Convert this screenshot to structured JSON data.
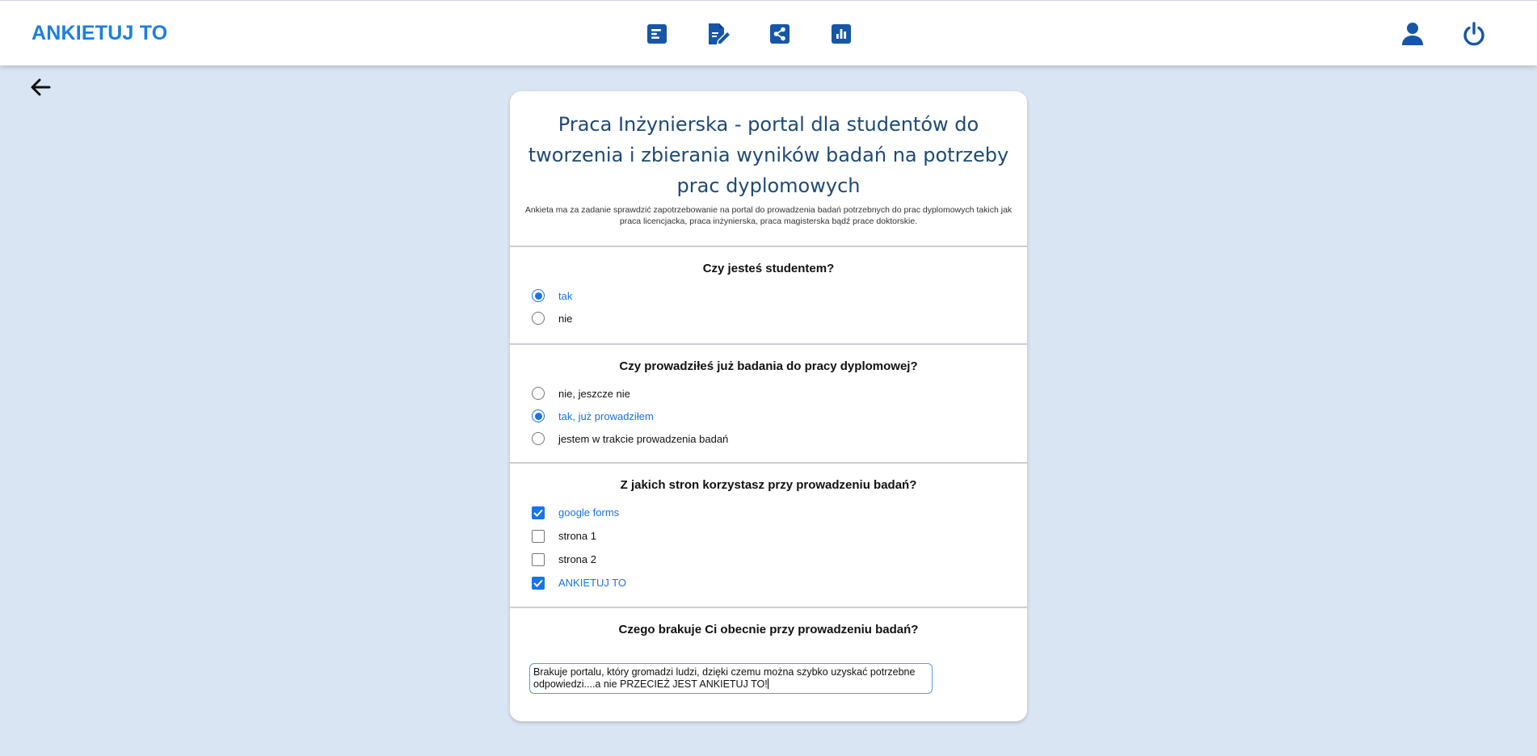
{
  "app": {
    "brand": "ANKIETUJ TO",
    "accent_color": "#1b7fe0",
    "icon_color": "#1556a8"
  },
  "nav": {
    "icons": [
      "survey-list-icon",
      "edit-survey-icon",
      "share-icon",
      "statistics-icon"
    ],
    "right_icons": [
      "user-icon",
      "power-icon"
    ]
  },
  "survey": {
    "title": "Praca Inżynierska - portal dla studentów do tworzenia i zbierania wyników badań na potrzeby prac dyplomowych",
    "description": "Ankieta ma za zadanie sprawdzić zapotrzebowanie na portal do prowadzenia badań potrzebnych do prac dyplomowych takich jak praca licencjacka, praca inżynierska, praca magisterska bądź prace doktorskie.",
    "questions": [
      {
        "title": "Czy jesteś studentem?",
        "type": "radio",
        "options": [
          {
            "label": "tak",
            "selected": true
          },
          {
            "label": "nie",
            "selected": false
          }
        ]
      },
      {
        "title": "Czy prowadziłeś już badania do pracy dyplomowej?",
        "type": "radio",
        "options": [
          {
            "label": "nie, jeszcze nie",
            "selected": false
          },
          {
            "label": "tak, już prowadziłem",
            "selected": true
          },
          {
            "label": "jestem w trakcie prowadzenia badań",
            "selected": false
          }
        ]
      },
      {
        "title": "Z jakich stron korzystasz przy prowadzeniu badań?",
        "type": "checkbox",
        "options": [
          {
            "label": "google forms",
            "selected": true
          },
          {
            "label": "strona 1",
            "selected": false
          },
          {
            "label": "strona 2",
            "selected": false
          },
          {
            "label": "ANKIETUJ TO",
            "selected": true
          }
        ]
      },
      {
        "title": "Czego brakuje Ci obecnie przy prowadzeniu badań?",
        "type": "text",
        "answer": "Brakuje portalu, który gromadzi ludzi, dzięki czemu można szybko uzyskać potrzebne odpowiedzi....a nie PRZECIEŻ JEST ANKIETUJ TO!"
      }
    ]
  }
}
